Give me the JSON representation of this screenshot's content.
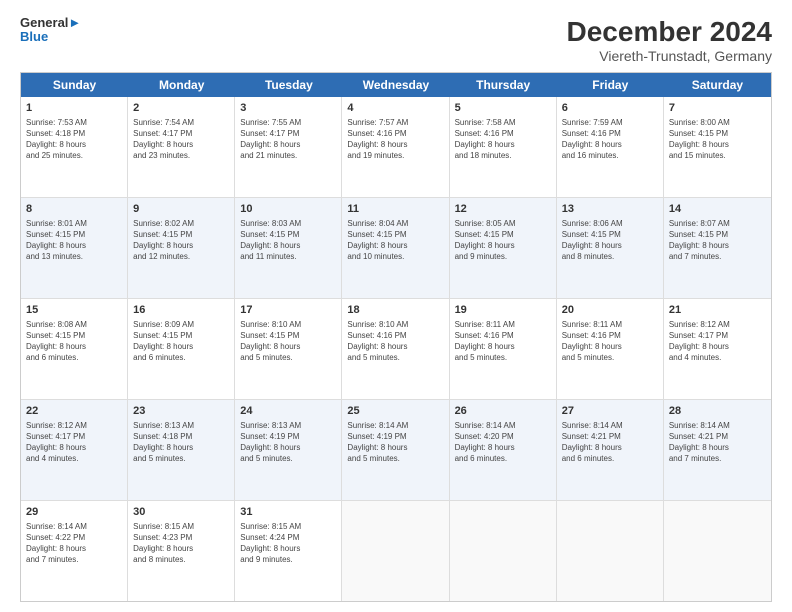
{
  "header": {
    "logo": {
      "line1": "General",
      "line2": "Blue"
    },
    "title": "December 2024",
    "location": "Viereth-Trunstadt, Germany"
  },
  "days_of_week": [
    "Sunday",
    "Monday",
    "Tuesday",
    "Wednesday",
    "Thursday",
    "Friday",
    "Saturday"
  ],
  "weeks": [
    {
      "alt": false,
      "cells": [
        {
          "day": "",
          "info": ""
        },
        {
          "day": "",
          "info": ""
        },
        {
          "day": "",
          "info": ""
        },
        {
          "day": "",
          "info": ""
        },
        {
          "day": "",
          "info": ""
        },
        {
          "day": "",
          "info": ""
        },
        {
          "day": "",
          "info": ""
        }
      ]
    },
    {
      "alt": false,
      "cells": [
        {
          "day": "1",
          "info": "Sunrise: 7:53 AM\nSunset: 4:18 PM\nDaylight: 8 hours\nand 25 minutes."
        },
        {
          "day": "2",
          "info": "Sunrise: 7:54 AM\nSunset: 4:17 PM\nDaylight: 8 hours\nand 23 minutes."
        },
        {
          "day": "3",
          "info": "Sunrise: 7:55 AM\nSunset: 4:17 PM\nDaylight: 8 hours\nand 21 minutes."
        },
        {
          "day": "4",
          "info": "Sunrise: 7:57 AM\nSunset: 4:16 PM\nDaylight: 8 hours\nand 19 minutes."
        },
        {
          "day": "5",
          "info": "Sunrise: 7:58 AM\nSunset: 4:16 PM\nDaylight: 8 hours\nand 18 minutes."
        },
        {
          "day": "6",
          "info": "Sunrise: 7:59 AM\nSunset: 4:16 PM\nDaylight: 8 hours\nand 16 minutes."
        },
        {
          "day": "7",
          "info": "Sunrise: 8:00 AM\nSunset: 4:15 PM\nDaylight: 8 hours\nand 15 minutes."
        }
      ]
    },
    {
      "alt": true,
      "cells": [
        {
          "day": "8",
          "info": "Sunrise: 8:01 AM\nSunset: 4:15 PM\nDaylight: 8 hours\nand 13 minutes."
        },
        {
          "day": "9",
          "info": "Sunrise: 8:02 AM\nSunset: 4:15 PM\nDaylight: 8 hours\nand 12 minutes."
        },
        {
          "day": "10",
          "info": "Sunrise: 8:03 AM\nSunset: 4:15 PM\nDaylight: 8 hours\nand 11 minutes."
        },
        {
          "day": "11",
          "info": "Sunrise: 8:04 AM\nSunset: 4:15 PM\nDaylight: 8 hours\nand 10 minutes."
        },
        {
          "day": "12",
          "info": "Sunrise: 8:05 AM\nSunset: 4:15 PM\nDaylight: 8 hours\nand 9 minutes."
        },
        {
          "day": "13",
          "info": "Sunrise: 8:06 AM\nSunset: 4:15 PM\nDaylight: 8 hours\nand 8 minutes."
        },
        {
          "day": "14",
          "info": "Sunrise: 8:07 AM\nSunset: 4:15 PM\nDaylight: 8 hours\nand 7 minutes."
        }
      ]
    },
    {
      "alt": false,
      "cells": [
        {
          "day": "15",
          "info": "Sunrise: 8:08 AM\nSunset: 4:15 PM\nDaylight: 8 hours\nand 6 minutes."
        },
        {
          "day": "16",
          "info": "Sunrise: 8:09 AM\nSunset: 4:15 PM\nDaylight: 8 hours\nand 6 minutes."
        },
        {
          "day": "17",
          "info": "Sunrise: 8:10 AM\nSunset: 4:15 PM\nDaylight: 8 hours\nand 5 minutes."
        },
        {
          "day": "18",
          "info": "Sunrise: 8:10 AM\nSunset: 4:16 PM\nDaylight: 8 hours\nand 5 minutes."
        },
        {
          "day": "19",
          "info": "Sunrise: 8:11 AM\nSunset: 4:16 PM\nDaylight: 8 hours\nand 5 minutes."
        },
        {
          "day": "20",
          "info": "Sunrise: 8:11 AM\nSunset: 4:16 PM\nDaylight: 8 hours\nand 5 minutes."
        },
        {
          "day": "21",
          "info": "Sunrise: 8:12 AM\nSunset: 4:17 PM\nDaylight: 8 hours\nand 4 minutes."
        }
      ]
    },
    {
      "alt": true,
      "cells": [
        {
          "day": "22",
          "info": "Sunrise: 8:12 AM\nSunset: 4:17 PM\nDaylight: 8 hours\nand 4 minutes."
        },
        {
          "day": "23",
          "info": "Sunrise: 8:13 AM\nSunset: 4:18 PM\nDaylight: 8 hours\nand 5 minutes."
        },
        {
          "day": "24",
          "info": "Sunrise: 8:13 AM\nSunset: 4:19 PM\nDaylight: 8 hours\nand 5 minutes."
        },
        {
          "day": "25",
          "info": "Sunrise: 8:14 AM\nSunset: 4:19 PM\nDaylight: 8 hours\nand 5 minutes."
        },
        {
          "day": "26",
          "info": "Sunrise: 8:14 AM\nSunset: 4:20 PM\nDaylight: 8 hours\nand 6 minutes."
        },
        {
          "day": "27",
          "info": "Sunrise: 8:14 AM\nSunset: 4:21 PM\nDaylight: 8 hours\nand 6 minutes."
        },
        {
          "day": "28",
          "info": "Sunrise: 8:14 AM\nSunset: 4:21 PM\nDaylight: 8 hours\nand 7 minutes."
        }
      ]
    },
    {
      "alt": false,
      "cells": [
        {
          "day": "29",
          "info": "Sunrise: 8:14 AM\nSunset: 4:22 PM\nDaylight: 8 hours\nand 7 minutes."
        },
        {
          "day": "30",
          "info": "Sunrise: 8:15 AM\nSunset: 4:23 PM\nDaylight: 8 hours\nand 8 minutes."
        },
        {
          "day": "31",
          "info": "Sunrise: 8:15 AM\nSunset: 4:24 PM\nDaylight: 8 hours\nand 9 minutes."
        },
        {
          "day": "",
          "info": ""
        },
        {
          "day": "",
          "info": ""
        },
        {
          "day": "",
          "info": ""
        },
        {
          "day": "",
          "info": ""
        }
      ]
    }
  ]
}
